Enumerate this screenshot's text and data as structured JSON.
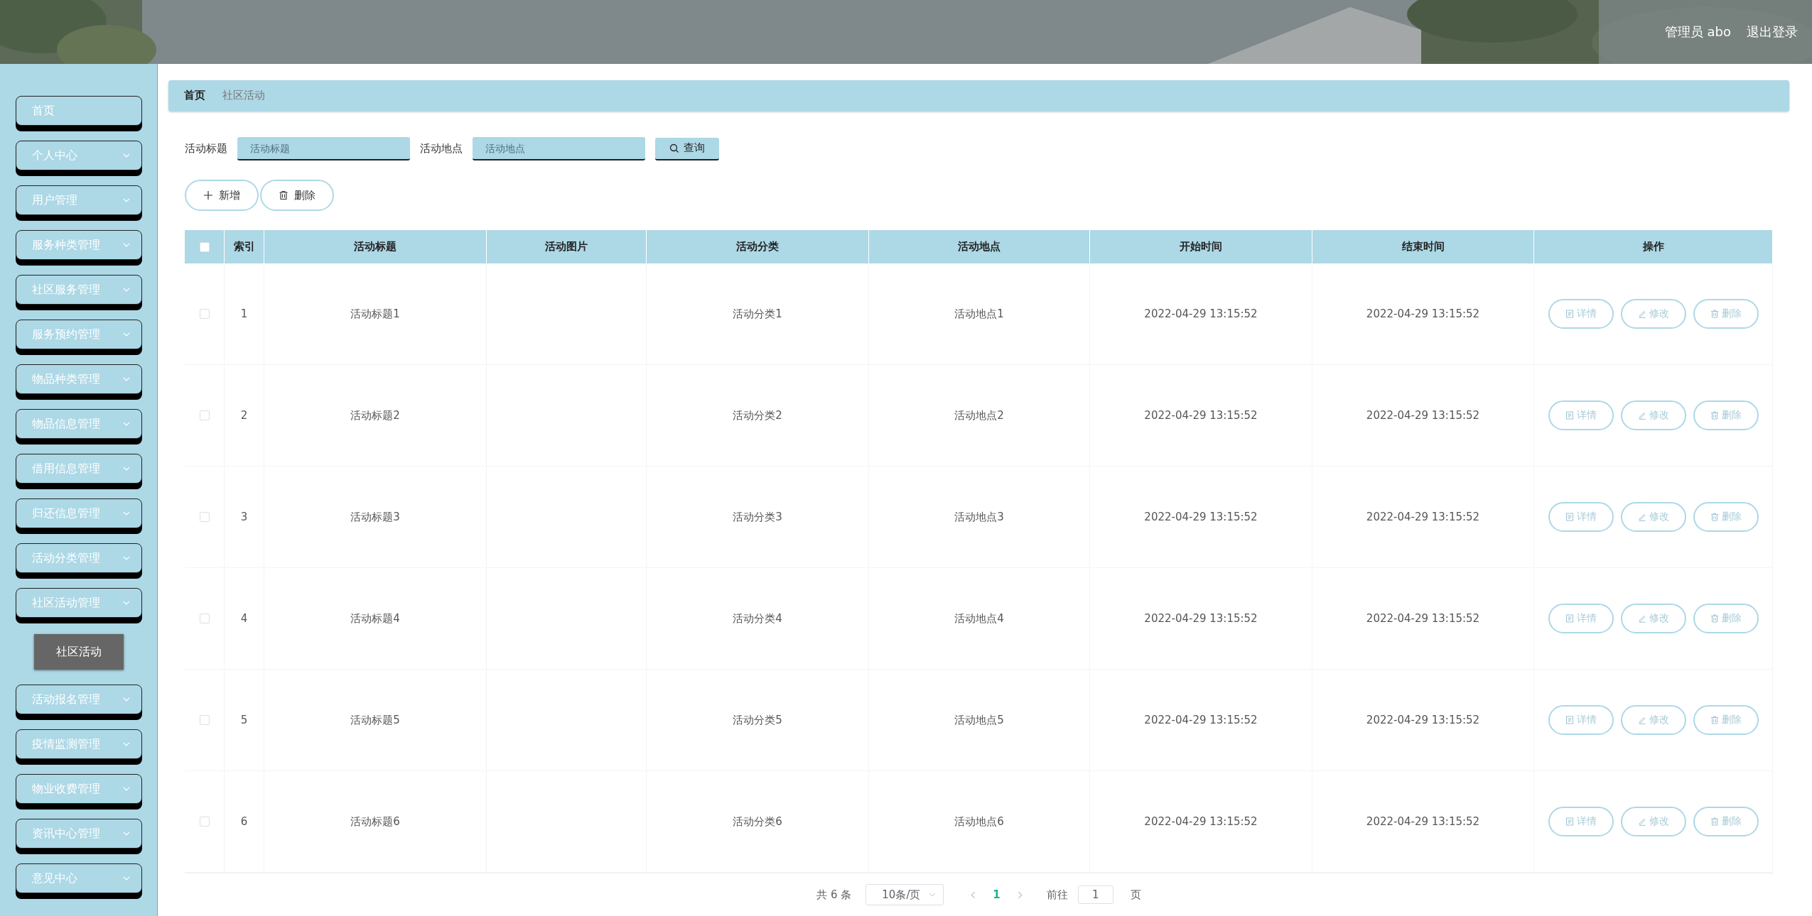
{
  "header": {
    "user": "管理员 abo",
    "logout": "退出登录"
  },
  "sidebar": {
    "items": [
      {
        "label": "首页",
        "kind": "link"
      },
      {
        "label": "个人中心",
        "kind": "menu"
      },
      {
        "label": "用户管理",
        "kind": "menu"
      },
      {
        "label": "服务种类管理",
        "kind": "menu"
      },
      {
        "label": "社区服务管理",
        "kind": "menu"
      },
      {
        "label": "服务预约管理",
        "kind": "menu"
      },
      {
        "label": "物品种类管理",
        "kind": "menu"
      },
      {
        "label": "物品信息管理",
        "kind": "menu"
      },
      {
        "label": "借用信息管理",
        "kind": "menu"
      },
      {
        "label": "归还信息管理",
        "kind": "menu"
      },
      {
        "label": "活动分类管理",
        "kind": "menu"
      },
      {
        "label": "社区活动管理",
        "kind": "menu",
        "children": [
          {
            "label": "社区活动",
            "selected": true
          }
        ]
      },
      {
        "label": "活动报名管理",
        "kind": "menu"
      },
      {
        "label": "疫情监测管理",
        "kind": "menu"
      },
      {
        "label": "物业收费管理",
        "kind": "menu"
      },
      {
        "label": "资讯中心管理",
        "kind": "menu"
      },
      {
        "label": "意见中心",
        "kind": "menu"
      }
    ]
  },
  "breadcrumb": [
    "首页",
    "社区活动"
  ],
  "search": {
    "fields": [
      {
        "label": "活动标题",
        "placeholder": "活动标题"
      },
      {
        "label": "活动地点",
        "placeholder": "活动地点"
      }
    ],
    "button": "查询"
  },
  "toolbar": [
    {
      "kind": "add",
      "label": "新增"
    },
    {
      "kind": "delete",
      "label": "删除"
    }
  ],
  "table": {
    "select_all": {
      "checked": false
    },
    "columns": [
      "索引",
      "活动标题",
      "活动图片",
      "活动分类",
      "活动地点",
      "开始时间",
      "结束时间",
      "操作"
    ],
    "rows": [
      {
        "checked": false,
        "index": "1",
        "title": "活动标题1",
        "category": "活动分类1",
        "location": "活动地点1",
        "start": "2022-04-29 13:15:52",
        "end": "2022-04-29 13:15:52",
        "actions": [
          {
            "kind": "detail",
            "label": "详情"
          },
          {
            "kind": "edit",
            "label": "修改"
          },
          {
            "kind": "delete",
            "label": "删除"
          }
        ]
      },
      {
        "checked": false,
        "index": "2",
        "title": "活动标题2",
        "category": "活动分类2",
        "location": "活动地点2",
        "start": "2022-04-29 13:15:52",
        "end": "2022-04-29 13:15:52",
        "actions": [
          {
            "kind": "detail",
            "label": "详情"
          },
          {
            "kind": "edit",
            "label": "修改"
          },
          {
            "kind": "delete",
            "label": "删除"
          }
        ]
      },
      {
        "checked": false,
        "index": "3",
        "title": "活动标题3",
        "category": "活动分类3",
        "location": "活动地点3",
        "start": "2022-04-29 13:15:52",
        "end": "2022-04-29 13:15:52",
        "actions": [
          {
            "kind": "detail",
            "label": "详情"
          },
          {
            "kind": "edit",
            "label": "修改"
          },
          {
            "kind": "delete",
            "label": "删除"
          }
        ]
      },
      {
        "checked": false,
        "index": "4",
        "title": "活动标题4",
        "category": "活动分类4",
        "location": "活动地点4",
        "start": "2022-04-29 13:15:52",
        "end": "2022-04-29 13:15:52",
        "actions": [
          {
            "kind": "detail",
            "label": "详情"
          },
          {
            "kind": "edit",
            "label": "修改"
          },
          {
            "kind": "delete",
            "label": "删除"
          }
        ]
      },
      {
        "checked": false,
        "index": "5",
        "title": "活动标题5",
        "category": "活动分类5",
        "location": "活动地点5",
        "start": "2022-04-29 13:15:52",
        "end": "2022-04-29 13:15:52",
        "actions": [
          {
            "kind": "detail",
            "label": "详情"
          },
          {
            "kind": "edit",
            "label": "修改"
          },
          {
            "kind": "delete",
            "label": "删除"
          }
        ]
      },
      {
        "checked": false,
        "index": "6",
        "title": "活动标题6",
        "category": "活动分类6",
        "location": "活动地点6",
        "start": "2022-04-29 13:15:52",
        "end": "2022-04-29 13:15:52",
        "actions": [
          {
            "kind": "detail",
            "label": "详情"
          },
          {
            "kind": "edit",
            "label": "修改"
          },
          {
            "kind": "delete",
            "label": "删除"
          }
        ]
      }
    ]
  },
  "pagination": {
    "total": "共 6 条",
    "page_size": "10条/页",
    "pages": [
      {
        "label": "1",
        "selected": true
      }
    ],
    "goto_label": "前往",
    "goto_value": "1",
    "goto_suffix": "页"
  }
}
